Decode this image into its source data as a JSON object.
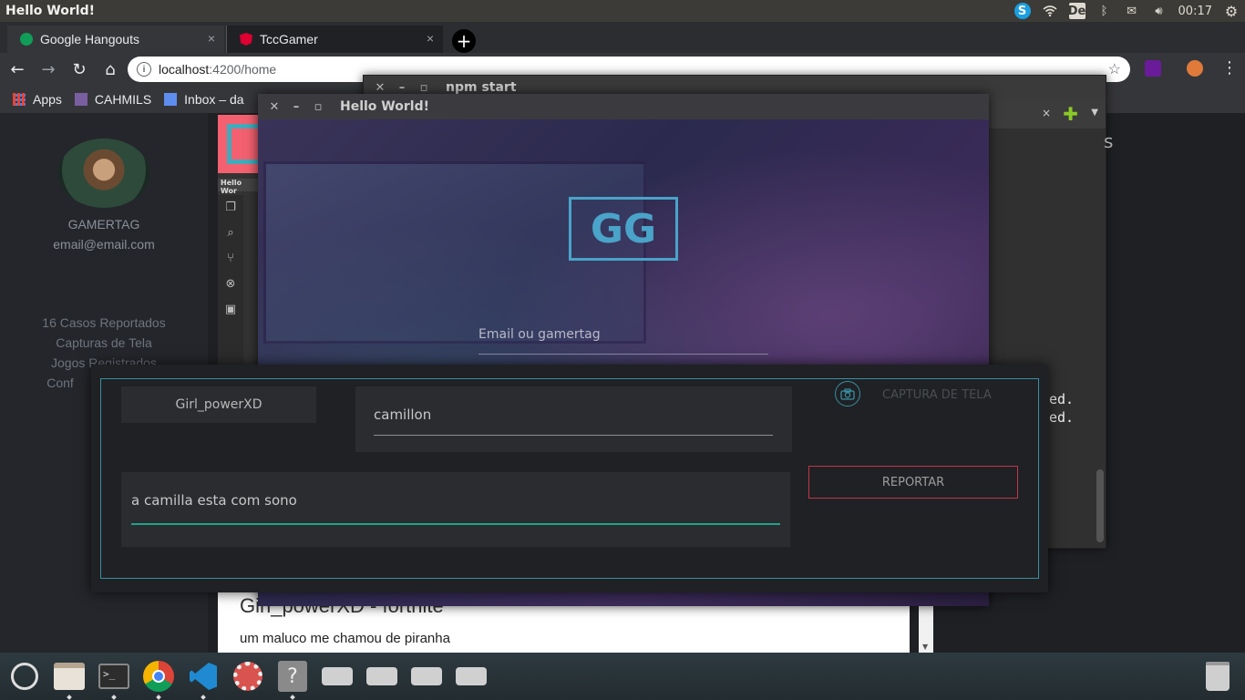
{
  "panel": {
    "window_title": "Hello World!",
    "keyboard": "De",
    "clock": "00:17",
    "skype_glyph": "S"
  },
  "browser": {
    "tabs": [
      {
        "label": "Google Hangouts",
        "icon": "hangouts-icon"
      },
      {
        "label": "TccGamer",
        "icon": "angular-icon"
      }
    ],
    "tab_close": "×",
    "new_tab": "+",
    "url_host": "localhost",
    "url_path": ":4200/home",
    "bookmarks": [
      {
        "label": "Apps"
      },
      {
        "label": "CAHMILS"
      },
      {
        "label": "Inbox – da"
      }
    ]
  },
  "sidebar": {
    "gamertag": "GAMERTAG",
    "email": "email@email.com",
    "menu": [
      "16 Casos Reportados",
      "Capturas de Tela",
      "Jogos Registrados",
      "Conf"
    ]
  },
  "feed": {
    "title": "Girl_powerXD - fortnite",
    "body": "um maluco me chamou de piranha"
  },
  "mini_vscode": {
    "label": "Hello Wor"
  },
  "npm_window": {
    "title": "npm start",
    "side_text": "s",
    "lines": [
      "ed.",
      "ed."
    ]
  },
  "login_window": {
    "title": "Hello World!",
    "logo": "GG",
    "email_placeholder": "Email ou gamertag"
  },
  "report_modal": {
    "reporter": "Girl_powerXD",
    "reported": "camillon",
    "screenshot_label": "CAPTURA DE TELA",
    "description": "a camilla esta com sono",
    "submit_label": "REPORTAR"
  },
  "colors": {
    "accent_cyan": "#3a8fa3",
    "report_red": "#c2354b",
    "desc_underline": "#1fa38a",
    "logo_blue": "#4aa3c8"
  }
}
